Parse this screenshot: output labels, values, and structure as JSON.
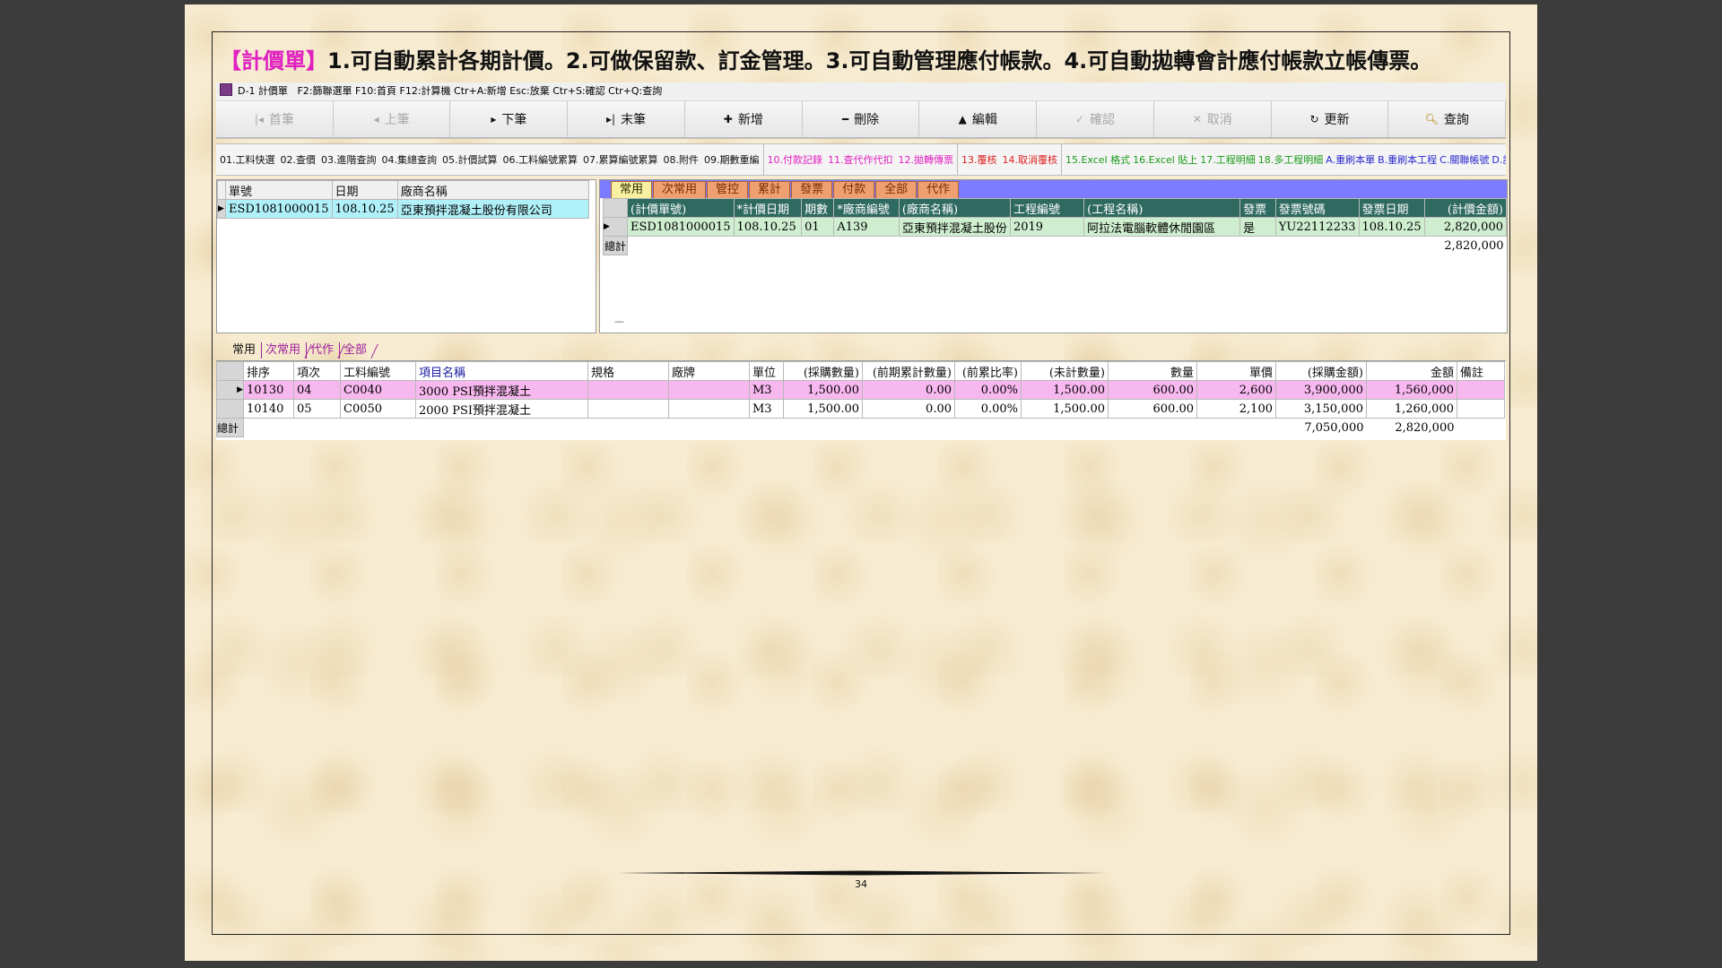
{
  "headline": {
    "tag": "【計價單】",
    "text": "1.可自動累計各期計價。2.可做保留款、訂金管理。3.可自動管理應付帳款。4.可自動拋轉會計應付帳款立帳傳票。"
  },
  "window": {
    "title": "D-1 計價單",
    "shortcuts": "F2:篩聯選單  F10:首頁  F12:計算機  Ctr+A:新增  Esc:放棄  Ctr+S:確認  Ctr+Q:查詢"
  },
  "toolbar": {
    "first": "首筆",
    "prev": "上筆",
    "next": "下筆",
    "last": "末筆",
    "add": "新增",
    "delete": "刪除",
    "edit": "編輯",
    "confirm": "確認",
    "cancel": "取消",
    "refresh": "更新",
    "query": "查詢"
  },
  "funcbar": {
    "group1": [
      "01.工料快選",
      "02.查價",
      "03.進階查詢",
      "04.集總查詢",
      "05.計價試算",
      "06.工料編號累算",
      "07.累算編號累算",
      "08.附件",
      "09.期數重編"
    ],
    "group2": [
      "10.付款記錄",
      "11.查代作代扣",
      "12.拋轉傳票"
    ],
    "group3": [
      "13.覆核",
      "14.取消覆核"
    ],
    "group4": [
      "15.Excel 格式",
      "16.Excel 貼上",
      "17.工程明細",
      "18.多工程明細"
    ],
    "group4_blue": [
      "A.重刷本單",
      "B.重刷本工程",
      "C.關聯帳號",
      "D.計"
    ]
  },
  "master": {
    "headers": [
      "單號",
      "日期",
      "廠商名稱"
    ],
    "rows": [
      [
        "ESD1081000015",
        "108.10.25",
        "亞東預拌混凝土股份有限公司"
      ]
    ]
  },
  "right_tabs": [
    "常用",
    "次常用",
    "管控",
    "累計",
    "發票",
    "付款",
    "全部",
    "代作"
  ],
  "right_grid": {
    "headers": [
      "(計價單號)",
      "*計價日期",
      "期數",
      "*廠商編號",
      "(廠商名稱)",
      "工程編號",
      "(工程名稱)",
      "發票",
      "發票號碼",
      "發票日期",
      "(計價金額)"
    ],
    "rows": [
      [
        "ESD1081000015",
        "108.10.25",
        "01",
        "A139",
        "亞東預拌混凝土股份",
        "2019",
        "阿拉法電腦軟體休閒園區",
        "是",
        "YU22112233",
        "108.10.25",
        "2,820,000"
      ]
    ],
    "total_label": "總計",
    "total": "2,820,000",
    "footer_dash": "—"
  },
  "lower_tabs": [
    "常用",
    "次常用",
    "代作",
    "全部"
  ],
  "detail": {
    "headers": [
      "排序",
      "項次",
      "工料編號",
      "項目名稱",
      "規格",
      "廠牌",
      "單位",
      "(採購數量)",
      "(前期累計數量)",
      "(前累比率)",
      "(未計數量)",
      "數量",
      "單價",
      "(採購金額)",
      "金額",
      "備註"
    ],
    "rows": [
      [
        "10130",
        "04",
        "C0040",
        "3000 PSI預拌混凝土",
        "",
        "",
        "M3",
        "1,500.00",
        "0.00",
        "0.00%",
        "1,500.00",
        "600.00",
        "2,600",
        "3,900,000",
        "1,560,000",
        ""
      ],
      [
        "10140",
        "05",
        "C0050",
        "2000 PSI預拌混凝土",
        "",
        "",
        "M3",
        "1,500.00",
        "0.00",
        "0.00%",
        "1,500.00",
        "600.00",
        "2,100",
        "3,150,000",
        "1,260,000",
        ""
      ]
    ],
    "total_label": "總計",
    "total_purchase": "7,050,000",
    "total_amount": "2,820,000"
  },
  "page_number": "34",
  "colors": {
    "tag": "#e020c0",
    "tab_bar": "#7b7bff",
    "header_dark": "#2f6a60",
    "selected_green": "#cfeecf",
    "selected_pink": "#f7b8ef"
  }
}
